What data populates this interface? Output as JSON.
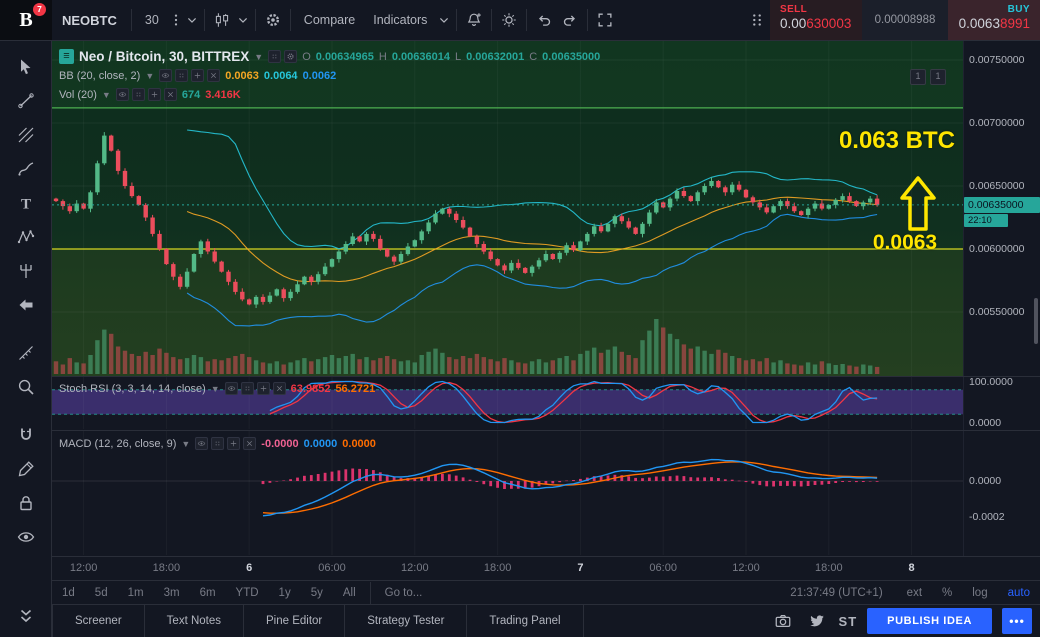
{
  "app": {
    "logo_letter": "B",
    "notification_count": "7"
  },
  "toolbar": {
    "symbol": "NEOBTC",
    "interval": "30",
    "compare_label": "Compare",
    "indicators_label": "Indicators",
    "sell_label": "SELL",
    "sell_price_prefix": "0.00",
    "sell_price_highlight": "630003",
    "spread": "0.00008988",
    "buy_label": "BUY",
    "buy_price_prefix": "0.0063",
    "buy_price_highlight": "8991"
  },
  "legend": {
    "title": "Neo / Bitcoin, 30, BITTREX",
    "ohlc": {
      "o_label": "O",
      "o": "0.00634965",
      "h_label": "H",
      "h": "0.00636014",
      "l_label": "L",
      "l": "0.00632001",
      "c_label": "C",
      "c": "0.00635000"
    },
    "bb": {
      "label": "BB (20, close, 2)",
      "values": [
        "0.0063",
        "0.0064",
        "0.0062"
      ]
    },
    "vol": {
      "label": "Vol (20)",
      "values": [
        "674",
        "3.416K"
      ]
    }
  },
  "stoch_legend": {
    "label": "Stoch RSI (3, 3, 14, 14, close)",
    "values": [
      "63.9852",
      "56.2721"
    ]
  },
  "macd_legend": {
    "label": "MACD (12, 26, close, 9)",
    "values": [
      "-0.0000",
      "0.0000",
      "0.0000"
    ]
  },
  "annotation": {
    "line1": "0.063 BTC",
    "line2": "0.0063"
  },
  "axis": {
    "price_labels": [
      "0.00750000",
      "0.00700000",
      "0.00650000",
      "0.00600000",
      "0.00550000"
    ],
    "current_price_label": "0.00635000",
    "countdown": "22:10",
    "stoch_labels": [
      "100.0000",
      "0.0000"
    ],
    "macd_labels": [
      "0.0000",
      "-0.0002"
    ],
    "time_labels": [
      {
        "label": "12:00",
        "i": 4
      },
      {
        "label": "18:00",
        "i": 16
      },
      {
        "label": "6",
        "i": 28,
        "day": true
      },
      {
        "label": "06:00",
        "i": 40
      },
      {
        "label": "12:00",
        "i": 52
      },
      {
        "label": "18:00",
        "i": 64
      },
      {
        "label": "7",
        "i": 76,
        "day": true
      },
      {
        "label": "06:00",
        "i": 88
      },
      {
        "label": "12:00",
        "i": 100
      },
      {
        "label": "18:00",
        "i": 112
      },
      {
        "label": "8",
        "i": 124,
        "day": true
      }
    ]
  },
  "range_toolbar": {
    "ranges": [
      "1d",
      "5d",
      "1m",
      "3m",
      "6m",
      "YTD",
      "1y",
      "5y",
      "All"
    ],
    "goto_label": "Go to...",
    "clock": "21:37:49 (UTC+1)",
    "modes": [
      {
        "label": "ext"
      },
      {
        "label": "%"
      },
      {
        "label": "log"
      },
      {
        "label": "auto",
        "active": true
      }
    ]
  },
  "footer": {
    "tabs": [
      "Screener",
      "Text Notes",
      "Pine Editor",
      "Strategy Tester",
      "Trading Panel"
    ],
    "st_label": "ST",
    "publish_label": "PUBLISH IDEA",
    "more_label": "•••"
  },
  "sidebar_icons": [
    "cursor-icon",
    "trendline-icon",
    "gann-icon",
    "brush-icon",
    "text-icon",
    "xabcd-icon",
    "prediction-icon",
    "arrow-left-icon",
    "measure-icon",
    "zoom-icon",
    "magnet-icon",
    "drawing-icon",
    "lock-icon",
    "eye-icon",
    "collapse-icon"
  ],
  "colors": {
    "up": "#53b987",
    "down": "#eb4d5c",
    "bb_basis": "#f5a623",
    "bb_upper": "#26c6da",
    "bb_lower": "#2196f3",
    "stoch_k": "#2196f3",
    "stoch_d": "#f23645",
    "stoch_band": "rgba(98,70,182,0.5)",
    "macd_line": "#2196f3",
    "macd_signal": "#ff6d00",
    "macd_hist": "#f23674",
    "annotation_yellow": "#ffe600",
    "price_tag_bg": "#26a69a",
    "sell_red": "#f23645",
    "buy_cyan": "#26c6da",
    "accent_blue": "#2962ff",
    "hline_green": "#4caf50",
    "hline_yellow": "#d6d622",
    "ohlc_green": "#26a69a"
  },
  "chart_data": {
    "type": "candlestick",
    "title": "Neo / Bitcoin, 30, BITTREX",
    "symbol": "NEOBTC",
    "exchange": "BITTREX",
    "interval_minutes": 30,
    "price_scale": 1e-05,
    "open_first": 640,
    "closes": [
      638,
      634,
      630,
      636,
      632,
      645,
      668,
      690,
      678,
      662,
      650,
      642,
      635,
      625,
      612,
      600,
      588,
      578,
      570,
      582,
      596,
      606,
      598,
      590,
      582,
      574,
      566,
      560,
      556,
      562,
      558,
      563,
      568,
      561,
      566,
      572,
      578,
      574,
      580,
      586,
      592,
      598,
      604,
      610,
      606,
      612,
      608,
      600,
      594,
      590,
      596,
      602,
      607,
      614,
      621,
      628,
      632,
      628,
      623,
      617,
      610,
      604,
      598,
      592,
      587,
      583,
      589,
      585,
      581,
      586,
      591,
      596,
      592,
      597,
      603,
      599,
      606,
      612,
      618,
      614,
      620,
      626,
      622,
      617,
      612,
      620,
      629,
      637,
      633,
      640,
      646,
      642,
      638,
      645,
      650,
      654,
      649,
      645,
      651,
      647,
      641,
      637,
      633,
      629,
      634,
      638,
      634,
      630,
      627,
      632,
      636,
      632,
      635,
      639,
      642,
      638,
      634,
      637,
      640,
      635
    ],
    "volumes": [
      1200,
      900,
      1500,
      1100,
      1000,
      1800,
      3200,
      4200,
      3800,
      2600,
      2200,
      1900,
      1700,
      2100,
      1800,
      2400,
      2000,
      1600,
      1400,
      1500,
      1800,
      1600,
      1200,
      1400,
      1300,
      1500,
      1700,
      1900,
      1600,
      1300,
      1100,
      1000,
      1200,
      900,
      1100,
      1300,
      1500,
      1200,
      1400,
      1600,
      1800,
      1500,
      1700,
      1900,
      1400,
      1600,
      1300,
      1500,
      1700,
      1400,
      1200,
      1300,
      1100,
      1800,
      2100,
      2400,
      2000,
      1600,
      1400,
      1700,
      1500,
      1900,
      1600,
      1400,
      1200,
      1500,
      1300,
      1100,
      1000,
      1200,
      1400,
      1100,
      1300,
      1500,
      1700,
      1300,
      1900,
      2200,
      2500,
      2000,
      2300,
      2600,
      2100,
      1800,
      1500,
      3200,
      4100,
      5200,
      4400,
      3800,
      3300,
      2800,
      2400,
      2600,
      2200,
      1900,
      2300,
      2000,
      1700,
      1500,
      1300,
      1400,
      1200,
      1500,
      1100,
      1300,
      1000,
      900,
      800,
      1100,
      900,
      1200,
      1000,
      850,
      950,
      800,
      700,
      900,
      800,
      674
    ],
    "ohlc_current": {
      "o": 0.00634965,
      "h": 0.00636014,
      "l": 0.00632001,
      "c": 0.00635
    },
    "current_price": 0.00635,
    "horizontal_lines": [
      {
        "price": 0.00712,
        "color": "#4caf50"
      },
      {
        "price": 0.006,
        "color": "#d6d622"
      }
    ],
    "y_axis_range": [
      0.0055,
      0.0075
    ],
    "indicators": {
      "bollinger": {
        "period": 20,
        "mult": 2
      },
      "volume_ma": 20,
      "stoch_rsi": {
        "k": 3,
        "d": 3,
        "rsi_len": 14,
        "stoch_len": 14,
        "bands": [
          80,
          20
        ],
        "range": [
          0,
          100
        ]
      },
      "macd": {
        "fast": 12,
        "slow": 26,
        "signal": 9,
        "axis": [
          0,
          -0.0002
        ]
      }
    }
  }
}
